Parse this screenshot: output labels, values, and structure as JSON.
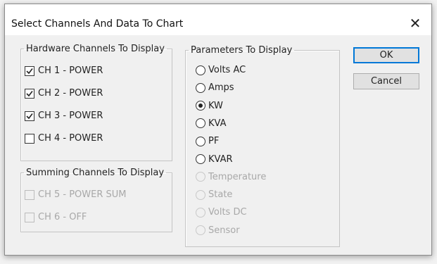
{
  "window": {
    "title": "Select Channels And Data To Chart",
    "close_glyph": "✕"
  },
  "hardware": {
    "legend": "Hardware Channels To Display",
    "items": [
      {
        "label": "CH 1 - POWER",
        "checked": true,
        "enabled": true
      },
      {
        "label": "CH 2 - POWER",
        "checked": true,
        "enabled": true
      },
      {
        "label": "CH 3 - POWER",
        "checked": true,
        "enabled": true
      },
      {
        "label": "CH 4 - POWER",
        "checked": false,
        "enabled": true
      }
    ]
  },
  "summing": {
    "legend": "Summing Channels To Display",
    "items": [
      {
        "label": "CH 5 - POWER SUM",
        "checked": false,
        "enabled": false
      },
      {
        "label": "CH 6 - OFF",
        "checked": false,
        "enabled": false
      }
    ]
  },
  "parameters": {
    "legend": "Parameters To Display",
    "items": [
      {
        "label": "Volts AC",
        "selected": false,
        "enabled": true
      },
      {
        "label": "Amps",
        "selected": false,
        "enabled": true
      },
      {
        "label": "KW",
        "selected": true,
        "enabled": true
      },
      {
        "label": "KVA",
        "selected": false,
        "enabled": true
      },
      {
        "label": "PF",
        "selected": false,
        "enabled": true
      },
      {
        "label": "KVAR",
        "selected": false,
        "enabled": true
      },
      {
        "label": "Temperature",
        "selected": false,
        "enabled": false
      },
      {
        "label": "State",
        "selected": false,
        "enabled": false
      },
      {
        "label": "Volts DC",
        "selected": false,
        "enabled": false
      },
      {
        "label": "Sensor",
        "selected": false,
        "enabled": false
      }
    ]
  },
  "buttons": {
    "ok_label": "OK",
    "cancel_label": "Cancel"
  },
  "colors": {
    "default_button_border": "#0078d7",
    "disabled_text": "#a8a8a8"
  }
}
